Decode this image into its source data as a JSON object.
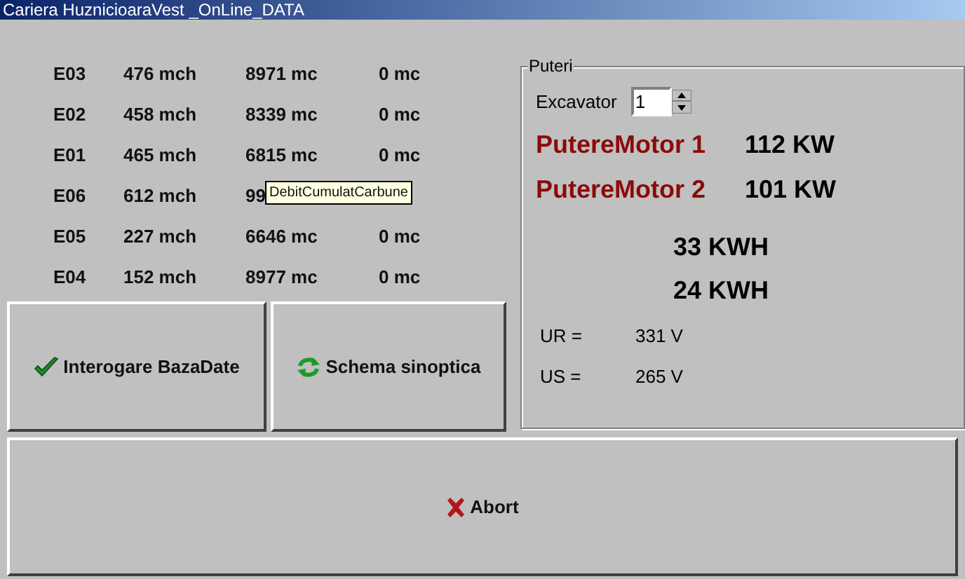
{
  "window": {
    "title": "Cariera HuznicioaraVest _OnLine_DATA"
  },
  "table": {
    "rows": [
      {
        "cells": [
          "E03",
          "476 mch",
          "8971 mc",
          "0 mc"
        ]
      },
      {
        "cells": [
          "E02",
          "458 mch",
          "8339 mc",
          "0 mc"
        ]
      },
      {
        "cells": [
          "E01",
          "465 mch",
          "6815 mc",
          "0 mc"
        ]
      },
      {
        "cells": [
          "E06",
          "612 mch",
          "99"
        ],
        "tooltip": "DebitCumulatCarbune"
      },
      {
        "cells": [
          "E05",
          "227 mch",
          "6646 mc",
          "0 mc"
        ]
      },
      {
        "cells": [
          "E04",
          "152 mch",
          "8977 mc",
          "0 mc"
        ]
      }
    ]
  },
  "puteri": {
    "title": "Puteri",
    "excavator_label": "Excavator",
    "excavator_value": "1",
    "motors": [
      {
        "label": "PutereMotor 1",
        "value": "112 KW"
      },
      {
        "label": "PutereMotor 2",
        "value": "101 KW"
      }
    ],
    "energy": [
      "33 KWH",
      "24 KWH"
    ],
    "voltages": [
      {
        "label": "UR =",
        "value": "331 V"
      },
      {
        "label": "US =",
        "value": "265 V"
      }
    ]
  },
  "buttons": [
    {
      "kind": "check",
      "label": "Interogare BazaDate"
    },
    {
      "kind": "refresh",
      "label": "Schema sinoptica"
    }
  ],
  "abort": {
    "kind": "cross",
    "label": "Abort"
  }
}
